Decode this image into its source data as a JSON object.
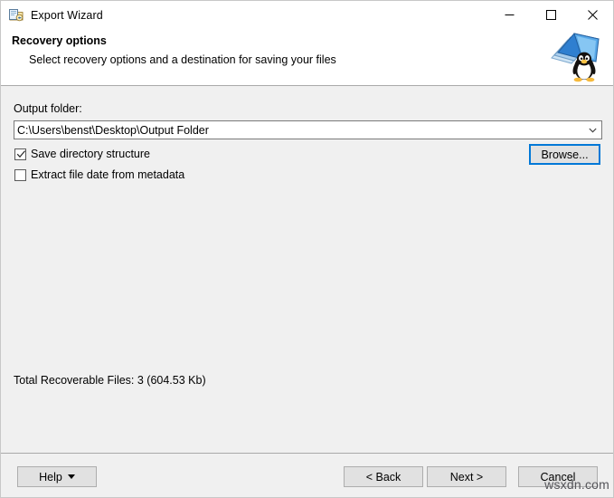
{
  "window": {
    "title": "Export Wizard",
    "icon": "export-folder-icon",
    "controls": {
      "minimize": "minimize-icon",
      "maximize": "maximize-icon",
      "close": "close-icon"
    }
  },
  "header": {
    "title": "Recovery options",
    "subtitle": "Select recovery options and a destination for saving your files",
    "logo": "linux-penguin-folder-logo"
  },
  "main": {
    "output_folder_label": "Output folder:",
    "output_folder_value": "C:\\Users\\benst\\Desktop\\Output Folder",
    "browse_label": "Browse...",
    "checkboxes": [
      {
        "label": "Save directory structure",
        "checked": true
      },
      {
        "label": "Extract file date from metadata",
        "checked": false
      }
    ],
    "total_text": "Total Recoverable Files: 3 (604.53 Kb)"
  },
  "footer": {
    "help_label": "Help",
    "back_label": "< Back",
    "next_label": "Next >",
    "cancel_label": "Cancel"
  },
  "watermark": "wsxdn.com",
  "colors": {
    "accent": "#0078d7",
    "panel": "#f0f0f0",
    "button_face": "#e1e1e1",
    "border": "#a9a9a9"
  }
}
